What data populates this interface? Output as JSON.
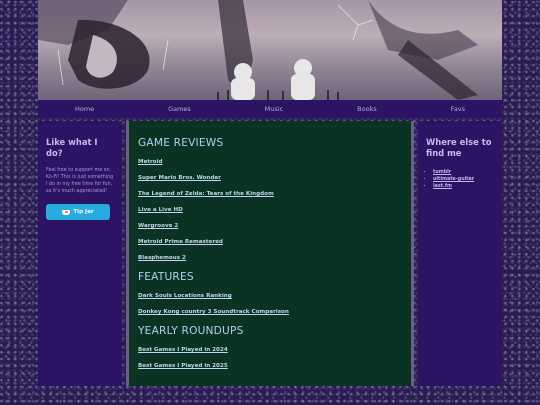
{
  "nav": {
    "items": [
      "Home",
      "Games",
      "Music",
      "Books",
      "Favs"
    ]
  },
  "left": {
    "title": "Like what I do?",
    "text": "Feel free to support me on Ko-Fi! This is just something I do in my free time for fun, so it's much appreciated!",
    "button_label": "Tip Jar"
  },
  "main": {
    "reviews_heading": "GAME REVIEWS",
    "reviews": [
      "Metroid",
      "Super Mario Bros. Wonder",
      "The Legend of Zelda: Tears of the Kingdom",
      "Live a Live HD",
      "Wargroove 2",
      "Metroid Prime Remastered",
      "Blasphemous 2"
    ],
    "features_heading": "FEATURES",
    "features": [
      "Dark Souls Locations Ranking",
      "Donkey Kong country 3 Soundtrack Comparison"
    ],
    "roundups_heading": "YEARLY ROUNDUPS",
    "roundups": [
      "Best Games I Played in 2024",
      "Best Games I Played in 2025"
    ]
  },
  "right": {
    "title": "Where else to find me",
    "links": [
      "tumblr",
      "ultimate-guitar",
      "last.fm"
    ]
  }
}
